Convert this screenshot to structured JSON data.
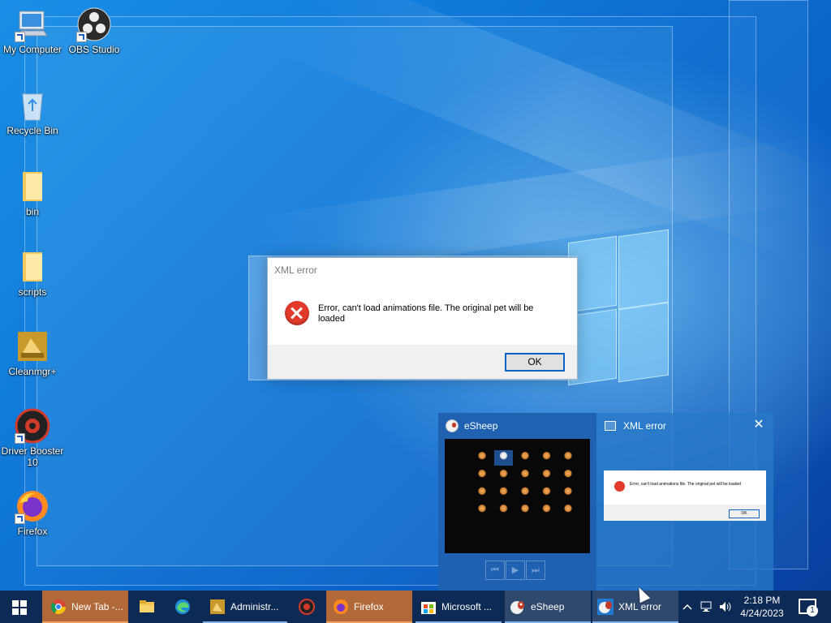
{
  "desktop": {
    "icons": [
      {
        "label": "My Computer",
        "icon": "computer-icon"
      },
      {
        "label": "OBS Studio",
        "icon": "obs-icon"
      },
      {
        "label": "Recycle Bin",
        "icon": "recycle-bin-icon"
      },
      {
        "label": "bin",
        "icon": "folder-icon"
      },
      {
        "label": "scripts",
        "icon": "folder-icon"
      },
      {
        "label": "Cleanmgr+",
        "icon": "cleanmgr-icon"
      },
      {
        "label": "Driver Booster 10",
        "line1": "Driver Booster",
        "line2": "10",
        "icon": "driver-booster-icon"
      },
      {
        "label": "Firefox",
        "icon": "firefox-icon"
      }
    ]
  },
  "dialog": {
    "title": "XML error",
    "message": "Error, can't load animations file. The original pet will be loaded",
    "ok_label": "OK"
  },
  "thumbnails": {
    "esheep_title": "eSheep",
    "xml_title": "XML error",
    "xml_preview_message": "Error, can't load animations file. The original pet will be loaded",
    "xml_preview_ok": "OK",
    "media_controls": [
      "previous",
      "play",
      "next"
    ]
  },
  "taskbar": {
    "items": [
      {
        "label": "New Tab -...",
        "icon": "chrome-icon"
      },
      {
        "label": "",
        "icon": "file-explorer-icon"
      },
      {
        "label": "",
        "icon": "edge-icon"
      },
      {
        "label": "Administr...",
        "icon": "cleanmgr-icon"
      },
      {
        "label": "",
        "icon": "driver-booster-icon"
      },
      {
        "label": "Firefox",
        "icon": "firefox-icon"
      },
      {
        "label": "Microsoft ...",
        "icon": "store-icon"
      },
      {
        "label": "eSheep",
        "icon": "esheep-icon"
      },
      {
        "label": "XML error",
        "icon": "esheep-icon"
      }
    ],
    "time": "2:18 PM",
    "date": "4/24/2023",
    "notification_count": "1"
  },
  "colors": {
    "taskbar": "#0d2a55",
    "accent": "#0b64c5",
    "error_red": "#e23a2b",
    "firefox_active": "#b2693a"
  }
}
